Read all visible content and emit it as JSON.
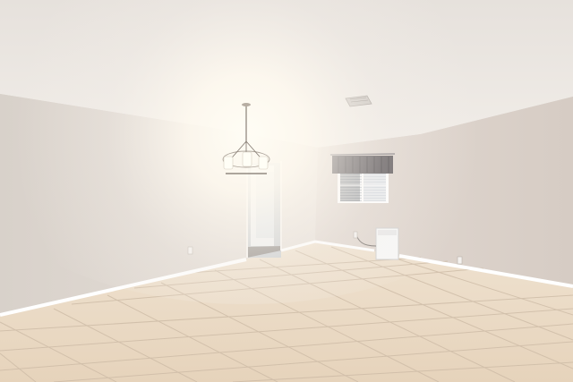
{
  "scene": {
    "subject": "empty-room-interior",
    "features": [
      "textured-ceiling",
      "chandelier",
      "window",
      "window-valance",
      "doorway",
      "ceiling-vent",
      "baseboards",
      "tile-floor",
      "dehumidifier",
      "wall-outlet"
    ]
  },
  "colors": {
    "ceiling": "#efebe6",
    "wall_left": "#e2dbd4",
    "wall_right": "#ddd3cc",
    "wall_back": "#dcd4cd",
    "floor_tile": "#ecdcc6",
    "grout": "#cbb8a2",
    "baseboard": "#ffffff",
    "valance": "#5a5558",
    "glow": "#fffdf5"
  }
}
